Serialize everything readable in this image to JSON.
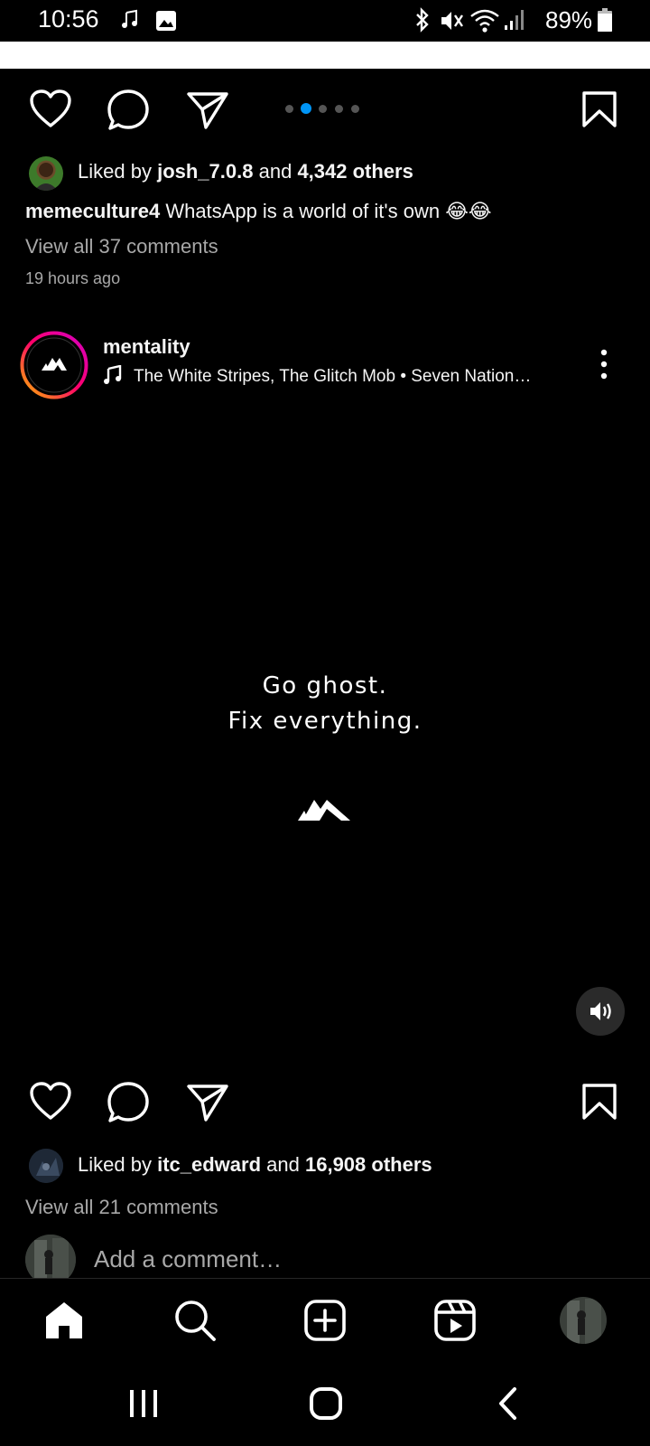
{
  "status_bar": {
    "time": "10:56",
    "battery": "89%",
    "icons": [
      "music-note-icon",
      "image-icon",
      "bluetooth-icon",
      "mute-icon",
      "wifi-icon",
      "signal-icon",
      "battery-icon"
    ]
  },
  "post1": {
    "carousel": {
      "count": 5,
      "active_index": 1,
      "accent": "#0095f6"
    },
    "likes": {
      "prefix": "Liked by",
      "user": "josh_7.0.8",
      "connector": "and",
      "others": "4,342 others"
    },
    "caption": {
      "username": "memeculture4",
      "text": "WhatsApp is a world of it's own 😂😂"
    },
    "view_comments": "View all 37 comments",
    "time_ago": "19 hours ago"
  },
  "post2": {
    "username": "mentality",
    "audio": "The White Stripes, The Glitch Mob • Seven Nation…",
    "video_text_line1": "Go ghost.",
    "video_text_line2": "Fix everything.",
    "likes": {
      "prefix": "Liked by",
      "user": "itc_edward",
      "connector": "and",
      "others": "16,908 others"
    },
    "view_comments": "View all 21 comments",
    "add_comment_placeholder": "Add a comment…"
  },
  "colors": {
    "background": "#000000",
    "text": "#f5f5f5",
    "muted": "#a8a8a8",
    "story_ring_start": "#d300c5",
    "story_ring_end": "#ffb800"
  }
}
